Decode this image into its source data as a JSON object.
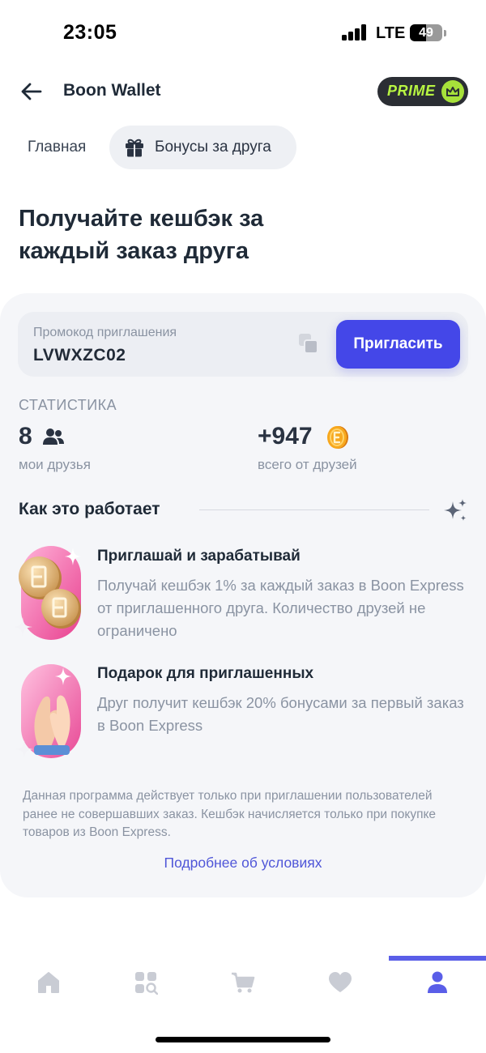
{
  "status_bar": {
    "time": "23:05",
    "network": "LTE",
    "battery": "49",
    "battery_level": 0.49
  },
  "header": {
    "title": "Boon Wallet",
    "prime_label": "PRIME"
  },
  "tabs": [
    {
      "label": "Главная",
      "active": false
    },
    {
      "label": "Бонусы за друга",
      "active": true
    }
  ],
  "headline": "Получайте кешбэк за каждый заказ друга",
  "promo": {
    "label": "Промокод приглашения",
    "code": "LVWXZC02",
    "invite_button": "Пригласить"
  },
  "stats": {
    "title": "СТАТИСТИКА",
    "friends_count": "8",
    "friends_label": "мои друзья",
    "bonus_amount": "+947",
    "bonus_label": "всего от друзей"
  },
  "how_it_works": {
    "title": "Как это работает",
    "items": [
      {
        "title": "Приглашай и зарабатывай",
        "desc": "Получай кешбэк 1% за каждый заказ в Boon Express от приглашенного друга. Количество друзей не ограничено"
      },
      {
        "title": "Подарок для приглашенных",
        "desc": "Друг получит кешбэк 20% бонусами за первый заказ в Boon Express"
      }
    ]
  },
  "disclaimer": "Данная программа действует только при приглашении пользователей ранее не совершавших заказ. Кешбэк начисляется только при покупке товаров из Boon Express.",
  "details_link": "Подробнее об условиях",
  "bottom_nav": {
    "items": [
      "home-icon",
      "catalog-search-icon",
      "cart-icon",
      "heart-icon",
      "profile-icon"
    ],
    "active_index": 4
  },
  "colors": {
    "accent": "#4447e8",
    "prime_bg": "#2b2e34",
    "prime_text": "#b8f542",
    "nav_inactive": "#c9ccd4",
    "nav_active": "#5a5ee8"
  }
}
